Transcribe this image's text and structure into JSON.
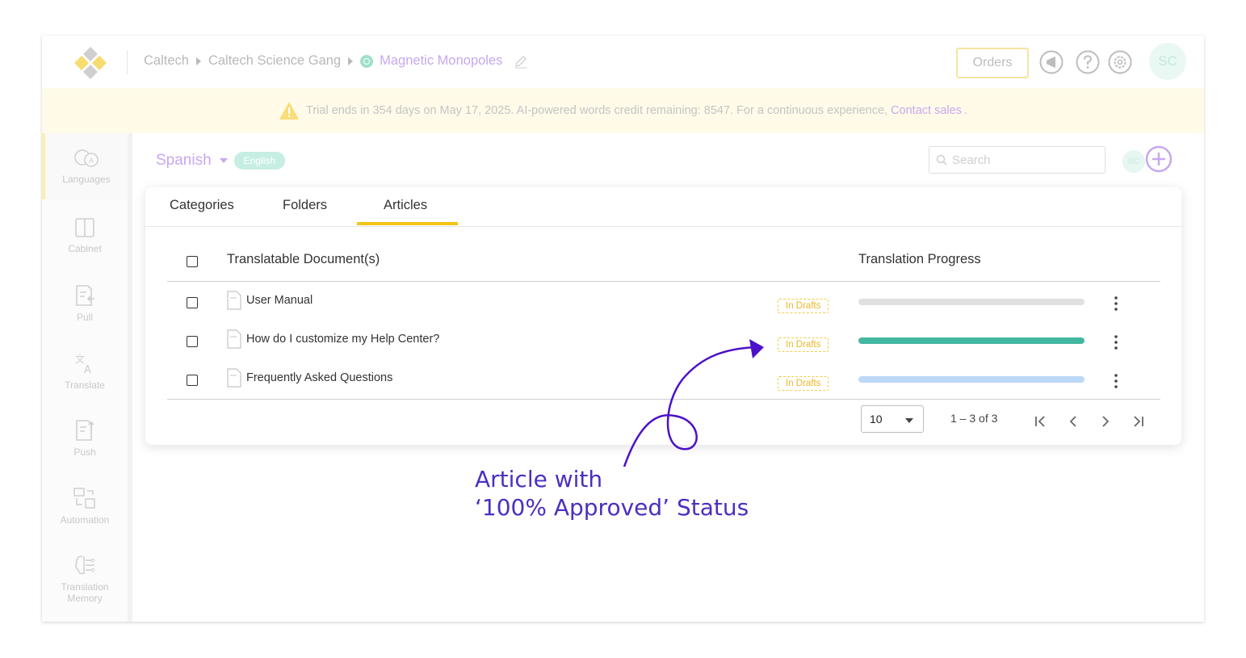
{
  "topbar": {
    "breadcrumb": [
      "Caltech",
      "Caltech Science Gang",
      "Magnetic Monopoles"
    ],
    "orders_label": "Orders",
    "avatar_initials": "SC",
    "icons": [
      "megaphone-icon",
      "help-icon",
      "gear-icon"
    ]
  },
  "banner": {
    "text": "Trial ends in 354 days on May 17, 2025. AI-powered words credit remaining: 8547. For a continuous experience,",
    "link": "Contact sales",
    "suffix": "."
  },
  "sidebar": {
    "items": [
      {
        "label": "Languages",
        "icon": "languages-icon"
      },
      {
        "label": "Cabinet",
        "icon": "cabinet-icon"
      },
      {
        "label": "Pull",
        "icon": "pull-icon"
      },
      {
        "label": "Translate",
        "icon": "translate-icon"
      },
      {
        "label": "Push",
        "icon": "push-icon"
      },
      {
        "label": "Automation",
        "icon": "automation-icon"
      },
      {
        "label": "Translation Memory",
        "icon": "translation-memory-icon"
      }
    ]
  },
  "main": {
    "language": "Spanish",
    "source_badge": "English",
    "search_placeholder": "Search",
    "small_avatar": "SC"
  },
  "tabs": [
    "Categories",
    "Folders",
    "Articles"
  ],
  "active_tab": "Articles",
  "table": {
    "columns": [
      "Translatable Document(s)",
      "Translation Progress"
    ],
    "rows": [
      {
        "title": "User Manual",
        "status": "In Drafts",
        "progress_color": "#e0e0e0",
        "progress": 0
      },
      {
        "title": "How do I customize my Help Center?",
        "status": "In Drafts",
        "progress_color": "#43b7a0",
        "progress": 1.0
      },
      {
        "title": "Frequently Asked Questions",
        "status": "In Drafts",
        "progress_color": "#bcd8f8",
        "progress": 1.0
      }
    ]
  },
  "pagination": {
    "per_page": "10",
    "range": "1 – 3 of 3"
  },
  "annotation": {
    "line1": "Article with",
    "line2": "‘100% Approved’ Status",
    "color": "#4c2fbf"
  }
}
